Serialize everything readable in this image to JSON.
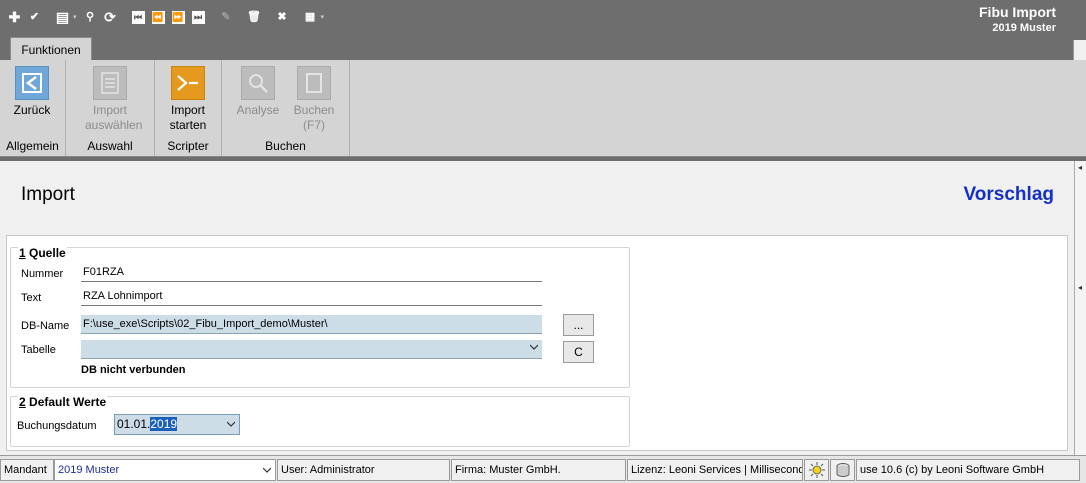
{
  "app": {
    "title": "Fibu Import",
    "subtitle": "2019 Muster"
  },
  "qat": {
    "icons": [
      "plus-icon",
      "check-icon",
      "print-icon",
      "search-icon",
      "refresh-icon",
      "first-icon",
      "prev-icon",
      "next-icon",
      "last-icon",
      "edit-icon",
      "delete-icon",
      "close-icon",
      "grid-icon"
    ],
    "glyphs": {
      "plus": "✚",
      "check": "✔",
      "print": "▤",
      "search": "⚲",
      "refresh": "⟳",
      "first": "⏮",
      "prev": "⏪",
      "next": "⏩",
      "last": "⏭",
      "edit": "✎",
      "delete": "🗑",
      "close": "✖",
      "grid": "▦",
      "dropdown": "▾"
    }
  },
  "ribbon": {
    "tab": "Funktionen",
    "groups": {
      "allgemein": {
        "label": "Allgemein",
        "zurueck": "Zurück"
      },
      "auswahl": {
        "label": "Auswahl",
        "import_line1": "Import",
        "import_line2": "auswählen"
      },
      "scripter": {
        "label": "Scripter",
        "start_line1": "Import",
        "start_line2": "starten"
      },
      "buchen": {
        "label": "Buchen",
        "analyse": "Analyse",
        "buchen_line1": "Buchen",
        "buchen_line2": "(F7)"
      }
    }
  },
  "main": {
    "title": "Import",
    "mode": "Vorschlag",
    "quelle": {
      "legend_num": "1",
      "legend_text": " Quelle",
      "nummer_label": "Nummer",
      "nummer_value": "F01RZA",
      "text_label": "Text",
      "text_value": "RZA Lohnimport",
      "dbname_label": "DB-Name",
      "dbname_value": "F:\\use_exe\\Scripts\\02_Fibu_Import_demo\\Muster\\",
      "browse_button": "...",
      "tabelle_label": "Tabelle",
      "tabelle_value": "",
      "c_button": "C",
      "db_status": "DB nicht verbunden"
    },
    "defaults": {
      "legend_num": "2",
      "legend_text": " Default Werte",
      "buchungsdatum_label": "Buchungsdatum",
      "date_prefix": "01.01.",
      "date_selected": "2019"
    }
  },
  "statusbar": {
    "mandant_label": "Mandant",
    "mandant_value": "2019 Muster",
    "user": "User: Administrator",
    "firma": "Firma: Muster GmbH.",
    "lizenz": "Lizenz: Leoni Services | Milliseconds",
    "version": "use 10.6 (c) by Leoni Software GmbH"
  }
}
